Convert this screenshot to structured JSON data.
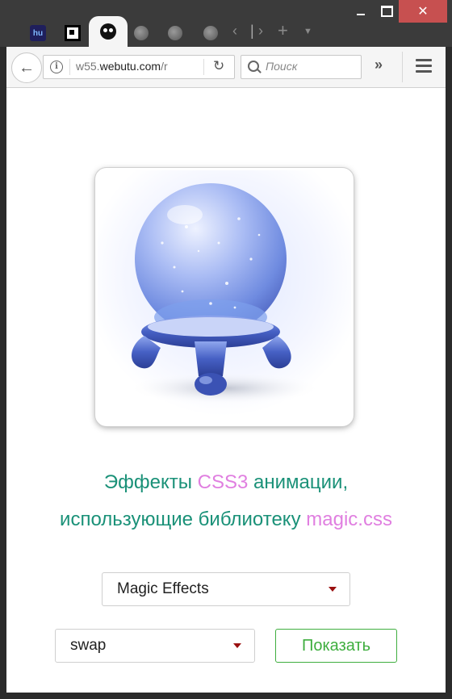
{
  "browser": {
    "url_prefix": "w55.",
    "url_domain": "webutu.com",
    "url_suffix": "/r",
    "search_placeholder": "Поиск",
    "tab_icons": [
      "hu-favicon",
      "qr-favicon",
      "alien-favicon",
      "globe-icon",
      "globe-icon",
      "globe-icon"
    ],
    "fav_hu_text": "hu"
  },
  "page": {
    "headline_part1": "Эффекты ",
    "headline_accent1": "CSS3",
    "headline_part2": " анимации,",
    "headline_part3": "использующие библиотеку ",
    "headline_accent2": "magic.css",
    "effects_select_value": "Magic Effects",
    "animation_select_value": "swap",
    "show_button_label": "Показать"
  },
  "colors": {
    "headline_green": "#1a9178",
    "accent_pink": "#e07fe0",
    "button_green": "#3fae3f",
    "caret_red": "#9a1010"
  }
}
